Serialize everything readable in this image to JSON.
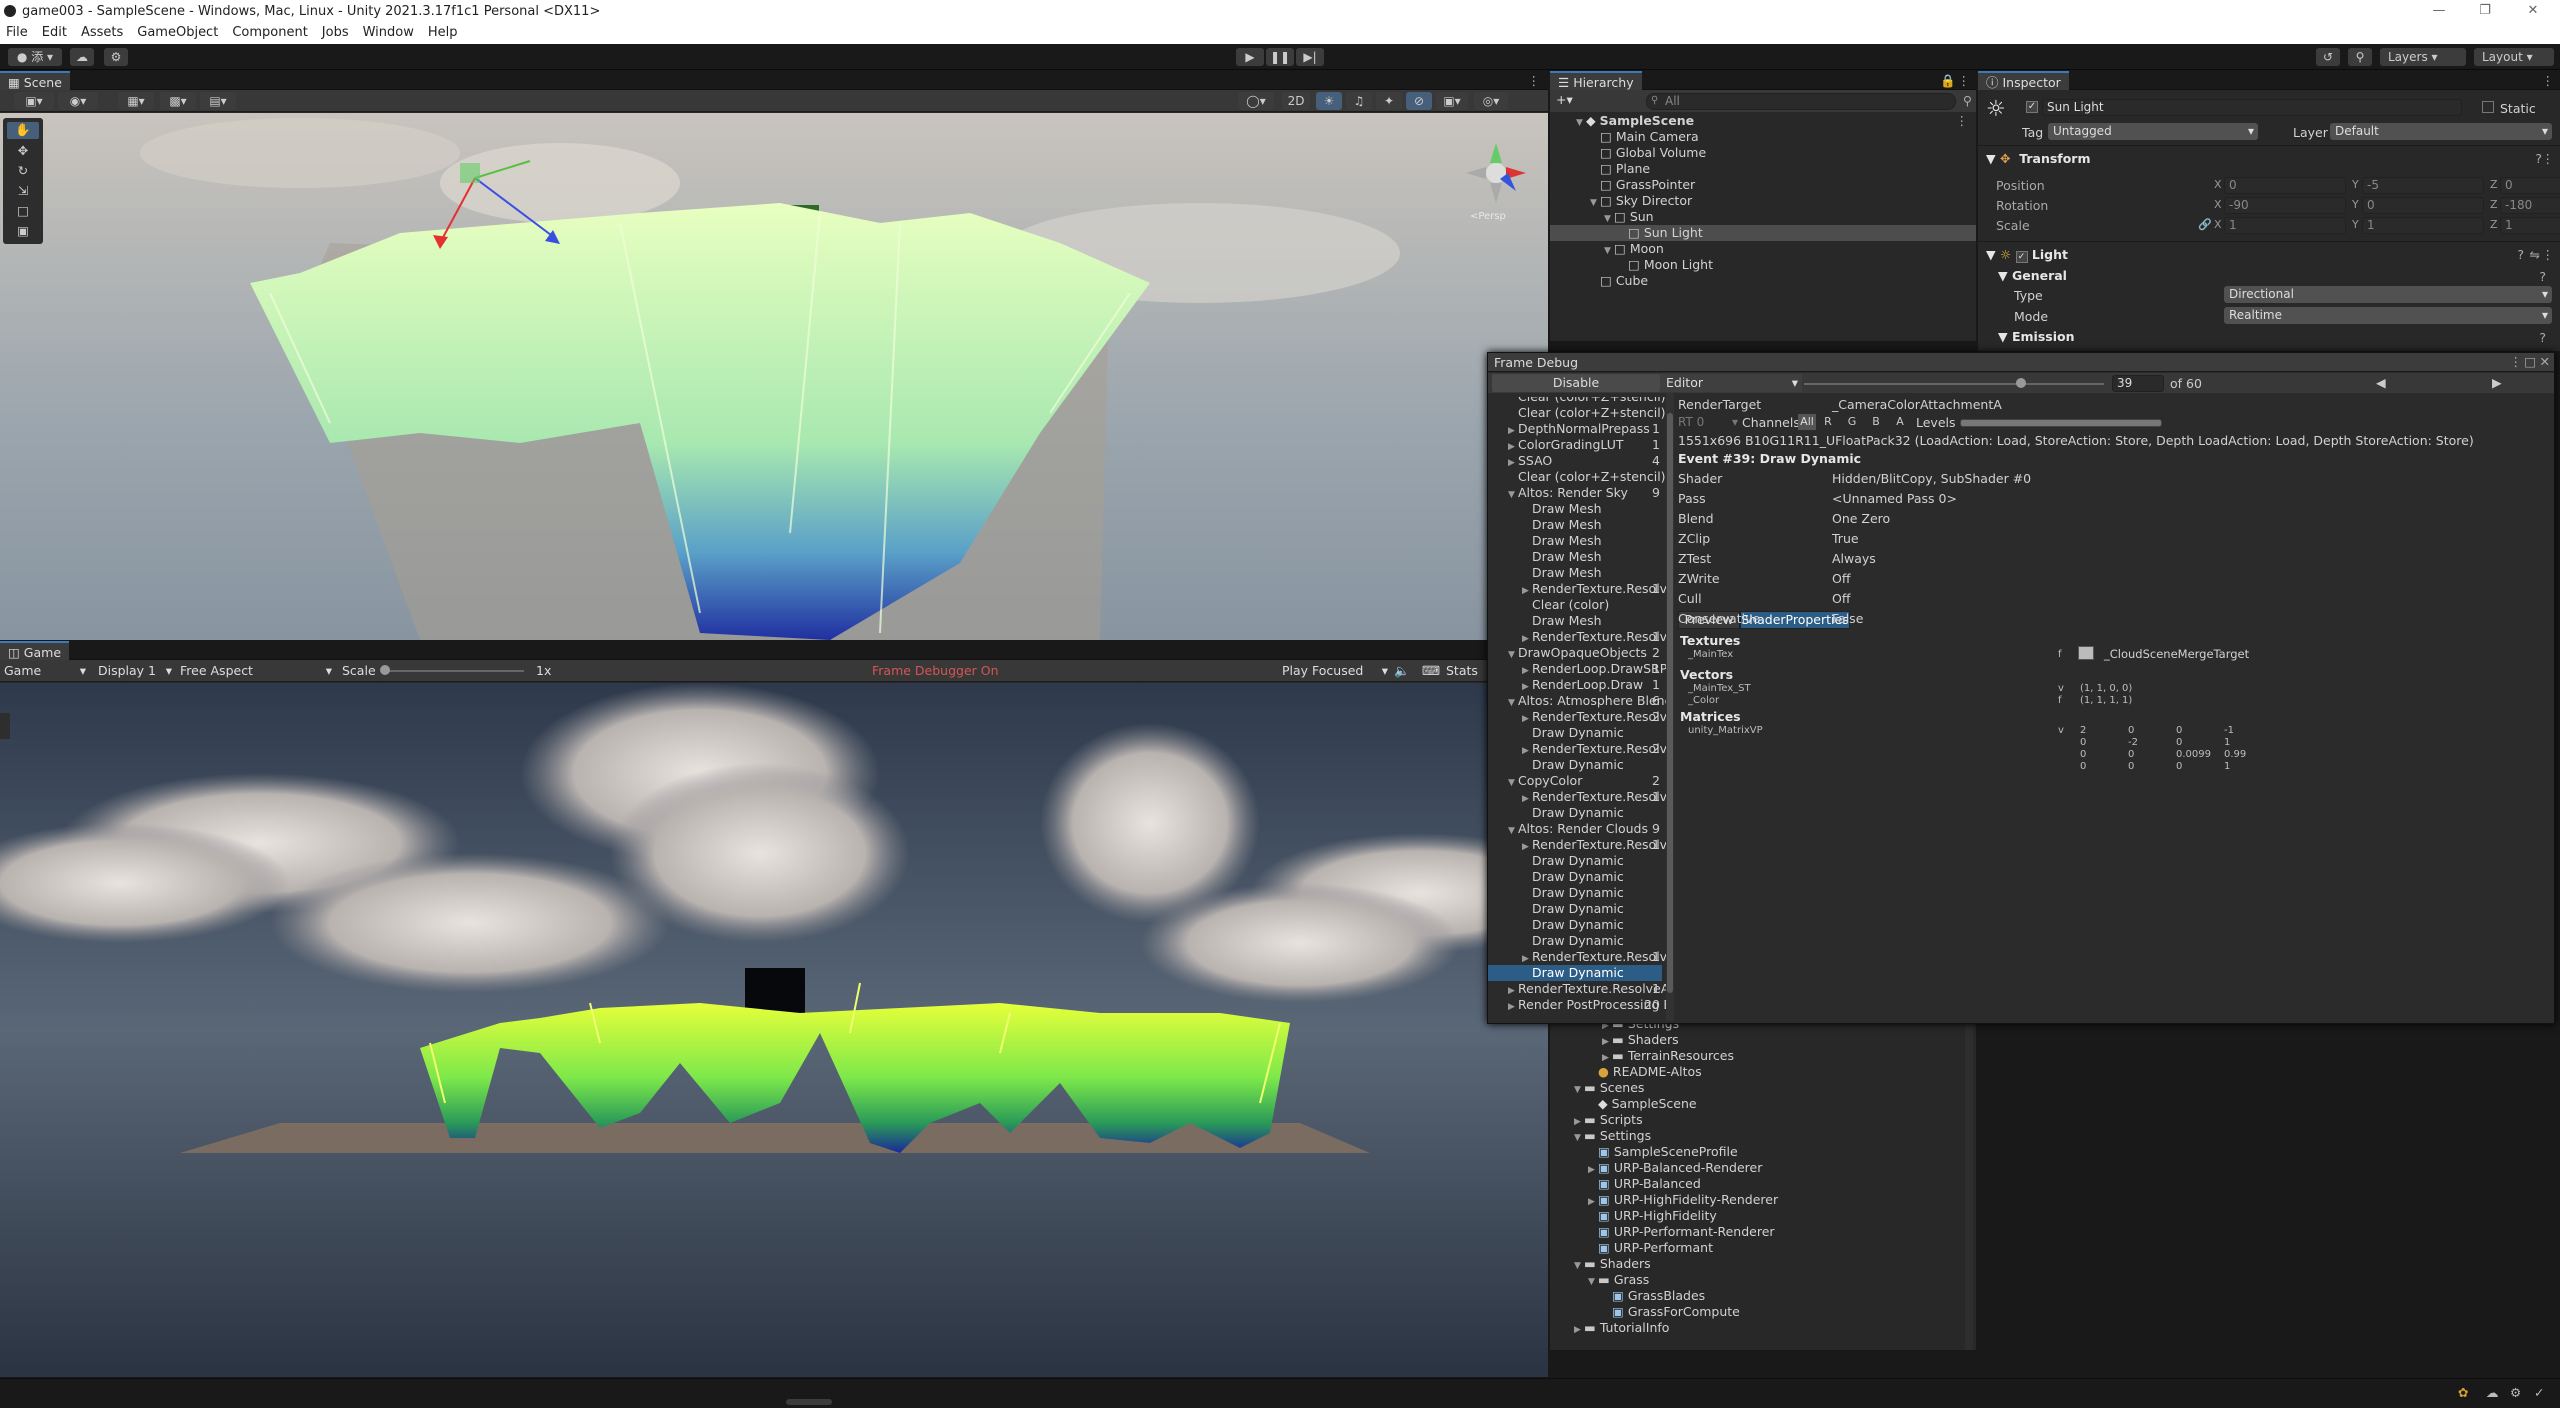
{
  "window": {
    "title": "game003 - SampleScene - Windows, Mac, Linux - Unity 2021.3.17f1c1 Personal <DX11>"
  },
  "menu": [
    "File",
    "Edit",
    "Assets",
    "GameObject",
    "Component",
    "Jobs",
    "Window",
    "Help"
  ],
  "toolbar": {
    "account": "添",
    "layers": "Layers",
    "layout": "Layout"
  },
  "scene": {
    "tab": "Scene",
    "btn_2d": "2D",
    "persp": "<Persp"
  },
  "game": {
    "tab": "Game",
    "view_select": "Game",
    "display": "Display 1",
    "aspect": "Free Aspect",
    "scale_label": "Scale",
    "scale_value": "1x",
    "frame_debugger": "Frame Debugger On",
    "play_focused": "Play Focused",
    "stats": "Stats"
  },
  "hierarchy": {
    "tab": "Hierarchy",
    "search_placeholder": "All",
    "items": [
      {
        "label": "SampleScene",
        "depth": 0,
        "arrow": "▼",
        "kind": "scene"
      },
      {
        "label": "Main Camera",
        "depth": 1,
        "arrow": "",
        "kind": "obj"
      },
      {
        "label": "Global Volume",
        "depth": 1,
        "arrow": "",
        "kind": "obj"
      },
      {
        "label": "Plane",
        "depth": 1,
        "arrow": "",
        "kind": "obj"
      },
      {
        "label": "GrassPointer",
        "depth": 1,
        "arrow": "",
        "kind": "obj"
      },
      {
        "label": "Sky Director",
        "depth": 1,
        "arrow": "▼",
        "kind": "obj"
      },
      {
        "label": "Sun",
        "depth": 2,
        "arrow": "▼",
        "kind": "obj"
      },
      {
        "label": "Sun Light",
        "depth": 3,
        "arrow": "",
        "kind": "obj",
        "selected": true
      },
      {
        "label": "Moon",
        "depth": 2,
        "arrow": "▼",
        "kind": "obj"
      },
      {
        "label": "Moon Light",
        "depth": 3,
        "arrow": "",
        "kind": "obj"
      },
      {
        "label": "Cube",
        "depth": 1,
        "arrow": "",
        "kind": "obj"
      }
    ]
  },
  "project": {
    "items": [
      {
        "label": "Settings",
        "depth": 3,
        "arrow": "▶",
        "kind": "folder"
      },
      {
        "label": "Shaders",
        "depth": 3,
        "arrow": "▶",
        "kind": "folder"
      },
      {
        "label": "TerrainResources",
        "depth": 3,
        "arrow": "▶",
        "kind": "folder"
      },
      {
        "label": "README-Altos",
        "depth": 2,
        "arrow": "",
        "kind": "chrome"
      },
      {
        "label": "Scenes",
        "depth": 1,
        "arrow": "▼",
        "kind": "folder"
      },
      {
        "label": "SampleScene",
        "depth": 2,
        "arrow": "",
        "kind": "scene"
      },
      {
        "label": "Scripts",
        "depth": 1,
        "arrow": "▶",
        "kind": "folder"
      },
      {
        "label": "Settings",
        "depth": 1,
        "arrow": "▼",
        "kind": "folder"
      },
      {
        "label": "SampleSceneProfile",
        "depth": 2,
        "arrow": "",
        "kind": "asset"
      },
      {
        "label": "URP-Balanced-Renderer",
        "depth": 2,
        "arrow": "▶",
        "kind": "asset"
      },
      {
        "label": "URP-Balanced",
        "depth": 2,
        "arrow": "",
        "kind": "asset"
      },
      {
        "label": "URP-HighFidelity-Renderer",
        "depth": 2,
        "arrow": "▶",
        "kind": "asset"
      },
      {
        "label": "URP-HighFidelity",
        "depth": 2,
        "arrow": "",
        "kind": "asset"
      },
      {
        "label": "URP-Performant-Renderer",
        "depth": 2,
        "arrow": "",
        "kind": "asset"
      },
      {
        "label": "URP-Performant",
        "depth": 2,
        "arrow": "",
        "kind": "asset"
      },
      {
        "label": "Shaders",
        "depth": 1,
        "arrow": "▼",
        "kind": "folder"
      },
      {
        "label": "Grass",
        "depth": 2,
        "arrow": "▼",
        "kind": "folder"
      },
      {
        "label": "GrassBlades",
        "depth": 3,
        "arrow": "",
        "kind": "asset"
      },
      {
        "label": "GrassForCompute",
        "depth": 3,
        "arrow": "",
        "kind": "asset"
      },
      {
        "label": "TutorialInfo",
        "depth": 1,
        "arrow": "▶",
        "kind": "folder"
      }
    ]
  },
  "inspector": {
    "tab": "Inspector",
    "object_name": "Sun Light",
    "static": "Static",
    "tag_label": "Tag",
    "tag_value": "Untagged",
    "layer_label": "Layer",
    "layer_value": "Default",
    "transform": {
      "title": "Transform",
      "position_label": "Position",
      "rotation_label": "Rotation",
      "scale_label": "Scale",
      "position": {
        "x": "0",
        "y": "-5",
        "z": "0"
      },
      "rotation": {
        "x": "-90",
        "y": "0",
        "z": "-180"
      },
      "scale": {
        "x": "1",
        "y": "1",
        "z": "1"
      }
    },
    "light": {
      "title": "Light",
      "general": "General",
      "type_label": "Type",
      "type_value": "Directional",
      "mode_label": "Mode",
      "mode_value": "Realtime",
      "emission": "Emission"
    }
  },
  "frame_debug": {
    "title": "Frame Debug",
    "disable": "Disable",
    "editor": "Editor",
    "event_index": "39",
    "event_total": "of 60",
    "events": [
      {
        "label": "Clear (color+Z+stencil)",
        "depth": 1,
        "arrow": "",
        "count": ""
      },
      {
        "label": "Clear (color+Z+stencil)",
        "depth": 1,
        "arrow": "",
        "count": ""
      },
      {
        "label": "DepthNormalPrepass",
        "depth": 1,
        "arrow": "▶",
        "count": "1"
      },
      {
        "label": "ColorGradingLUT",
        "depth": 1,
        "arrow": "▶",
        "count": "1"
      },
      {
        "label": "SSAO",
        "depth": 1,
        "arrow": "▶",
        "count": "4"
      },
      {
        "label": "Clear (color+Z+stencil)",
        "depth": 1,
        "arrow": "",
        "count": ""
      },
      {
        "label": "Altos: Render Sky",
        "depth": 1,
        "arrow": "▼",
        "count": "9"
      },
      {
        "label": "Draw Mesh",
        "depth": 2,
        "arrow": "",
        "count": ""
      },
      {
        "label": "Draw Mesh",
        "depth": 2,
        "arrow": "",
        "count": ""
      },
      {
        "label": "Draw Mesh",
        "depth": 2,
        "arrow": "",
        "count": ""
      },
      {
        "label": "Draw Mesh",
        "depth": 2,
        "arrow": "",
        "count": ""
      },
      {
        "label": "Draw Mesh",
        "depth": 2,
        "arrow": "",
        "count": ""
      },
      {
        "label": "RenderTexture.ResolveAA",
        "depth": 2,
        "arrow": "▶",
        "count": "1"
      },
      {
        "label": "Clear (color)",
        "depth": 2,
        "arrow": "",
        "count": ""
      },
      {
        "label": "Draw Mesh",
        "depth": 2,
        "arrow": "",
        "count": ""
      },
      {
        "label": "RenderTexture.ResolveAA",
        "depth": 2,
        "arrow": "▶",
        "count": "1"
      },
      {
        "label": "DrawOpaqueObjects",
        "depth": 1,
        "arrow": "▼",
        "count": "2"
      },
      {
        "label": "RenderLoop.DrawSRPBatcher",
        "depth": 2,
        "arrow": "▶",
        "count": "1"
      },
      {
        "label": "RenderLoop.Draw",
        "depth": 2,
        "arrow": "▶",
        "count": "1"
      },
      {
        "label": "Altos: Atmosphere Blending",
        "depth": 1,
        "arrow": "▼",
        "count": "6"
      },
      {
        "label": "RenderTexture.ResolveAA",
        "depth": 2,
        "arrow": "▶",
        "count": "2"
      },
      {
        "label": "Draw Dynamic",
        "depth": 2,
        "arrow": "",
        "count": ""
      },
      {
        "label": "RenderTexture.ResolveAA",
        "depth": 2,
        "arrow": "▶",
        "count": "2"
      },
      {
        "label": "Draw Dynamic",
        "depth": 2,
        "arrow": "",
        "count": ""
      },
      {
        "label": "CopyColor",
        "depth": 1,
        "arrow": "▼",
        "count": "2"
      },
      {
        "label": "RenderTexture.ResolveAA",
        "depth": 2,
        "arrow": "▶",
        "count": "1"
      },
      {
        "label": "Draw Dynamic",
        "depth": 2,
        "arrow": "",
        "count": ""
      },
      {
        "label": "Altos: Render Clouds",
        "depth": 1,
        "arrow": "▼",
        "count": "9"
      },
      {
        "label": "RenderTexture.ResolveAA",
        "depth": 2,
        "arrow": "▶",
        "count": "1"
      },
      {
        "label": "Draw Dynamic",
        "depth": 2,
        "arrow": "",
        "count": ""
      },
      {
        "label": "Draw Dynamic",
        "depth": 2,
        "arrow": "",
        "count": ""
      },
      {
        "label": "Draw Dynamic",
        "depth": 2,
        "arrow": "",
        "count": ""
      },
      {
        "label": "Draw Dynamic",
        "depth": 2,
        "arrow": "",
        "count": ""
      },
      {
        "label": "Draw Dynamic",
        "depth": 2,
        "arrow": "",
        "count": ""
      },
      {
        "label": "Draw Dynamic",
        "depth": 2,
        "arrow": "",
        "count": ""
      },
      {
        "label": "RenderTexture.ResolveAA",
        "depth": 2,
        "arrow": "▶",
        "count": "1"
      },
      {
        "label": "Draw Dynamic",
        "depth": 2,
        "arrow": "",
        "count": "",
        "selected": true
      },
      {
        "label": "RenderTexture.ResolveAA",
        "depth": 1,
        "arrow": "▶",
        "count": "1"
      },
      {
        "label": "Render PostProcessing Effects",
        "depth": 1,
        "arrow": "▶",
        "count": "20"
      }
    ],
    "render_target_label": "RenderTarget",
    "render_target_value": "_CameraColorAttachmentA",
    "rt_label": "RT 0",
    "channels_label": "Channels",
    "channels": [
      "All",
      "R",
      "G",
      "B",
      "A"
    ],
    "levels_label": "Levels",
    "format_line": "1551x696 B10G11R11_UFloatPack32 (LoadAction: Load, StoreAction: Store, Depth LoadAction: Load, Depth StoreAction: Store)",
    "event_title": "Event #39: Draw Dynamic",
    "props": [
      {
        "k": "Shader",
        "v": "Hidden/BlitCopy, SubShader #0"
      },
      {
        "k": "Pass",
        "v": "<Unnamed Pass 0>"
      },
      {
        "k": "Blend",
        "v": "One Zero"
      },
      {
        "k": "ZClip",
        "v": "True"
      },
      {
        "k": "ZTest",
        "v": "Always"
      },
      {
        "k": "ZWrite",
        "v": "Off"
      },
      {
        "k": "Cull",
        "v": "Off"
      },
      {
        "k": "Conservative",
        "v": "False"
      }
    ],
    "tabs": [
      "Preview",
      "ShaderProperties"
    ],
    "textures_label": "Textures",
    "maintex_name": "_MainTex",
    "maintex_stage": "f",
    "maintex_value": "_CloudSceneMergeTarget",
    "vectors_label": "Vectors",
    "vectors": [
      {
        "name": "_MainTex_ST",
        "stage": "v",
        "value": "(1, 1, 0, 0)"
      },
      {
        "name": "_Color",
        "stage": "f",
        "value": "(1, 1, 1, 1)"
      }
    ],
    "matrices_label": "Matrices",
    "matrix_name": "unity_MatrixVP",
    "matrix_stage": "v",
    "matrix": [
      [
        "2",
        "0",
        "0",
        "-1"
      ],
      [
        "0",
        "-2",
        "0",
        "1"
      ],
      [
        "0",
        "0",
        "0.0099",
        "0.99"
      ],
      [
        "0",
        "0",
        "0",
        "1"
      ]
    ]
  },
  "colors": {
    "accent": "#3a79bb",
    "selection": "#2c5d87",
    "panel": "#282828",
    "dark": "#191919",
    "grass_top": "#e6ff3a",
    "grass_bottom": "#1a2a9a"
  }
}
